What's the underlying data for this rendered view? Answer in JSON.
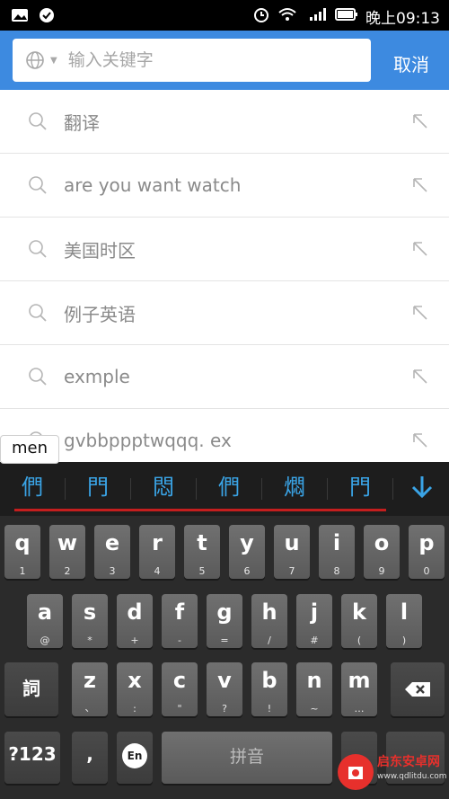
{
  "status_bar": {
    "time": "晚上09:13"
  },
  "search": {
    "placeholder": "输入关键字",
    "value": "",
    "cancel_label": "取消"
  },
  "suggestions": [
    {
      "text": "翻译"
    },
    {
      "text": "are you want watch"
    },
    {
      "text": "美国时区"
    },
    {
      "text": "例子英语"
    },
    {
      "text": "exmple"
    },
    {
      "text": "gvbbppptwqqq.   ex"
    }
  ],
  "ime": {
    "composition": "men",
    "candidates": [
      "們",
      "門",
      "悶",
      "們",
      "燜",
      "門"
    ],
    "rows": [
      [
        {
          "k": "q",
          "s": "1"
        },
        {
          "k": "w",
          "s": "2"
        },
        {
          "k": "e",
          "s": "3"
        },
        {
          "k": "r",
          "s": "4"
        },
        {
          "k": "t",
          "s": "5"
        },
        {
          "k": "y",
          "s": "6"
        },
        {
          "k": "u",
          "s": "7"
        },
        {
          "k": "i",
          "s": "8"
        },
        {
          "k": "o",
          "s": "9"
        },
        {
          "k": "p",
          "s": "0"
        }
      ],
      [
        {
          "k": "a",
          "s": "@"
        },
        {
          "k": "s",
          "s": "*"
        },
        {
          "k": "d",
          "s": "+"
        },
        {
          "k": "f",
          "s": "-"
        },
        {
          "k": "g",
          "s": "="
        },
        {
          "k": "h",
          "s": "/"
        },
        {
          "k": "j",
          "s": "#"
        },
        {
          "k": "k",
          "s": "("
        },
        {
          "k": "l",
          "s": ")"
        }
      ],
      [
        {
          "k": "z",
          "s": "、"
        },
        {
          "k": "x",
          "s": ":"
        },
        {
          "k": "c",
          "s": "\""
        },
        {
          "k": "v",
          "s": "?"
        },
        {
          "k": "b",
          "s": "!"
        },
        {
          "k": "n",
          "s": "~"
        },
        {
          "k": "m",
          "s": "…"
        }
      ]
    ],
    "special": {
      "chinese_switch": "詞",
      "numbers": "?123",
      "comma": ",",
      "lang": "En",
      "space": "拼音"
    }
  },
  "watermark": {
    "text": "启东安卓网",
    "url": "www.qdlitdu.com"
  }
}
